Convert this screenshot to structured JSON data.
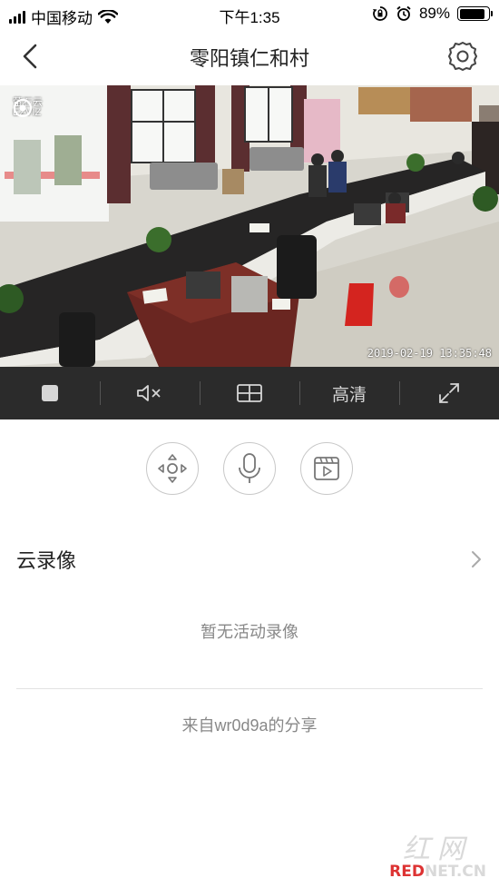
{
  "status_bar": {
    "carrier": "中国移动",
    "time": "下午1:35",
    "battery": "89%",
    "battery_level": 0.89,
    "icons": [
      "signal-icon",
      "wifi-icon",
      "rotation-lock-icon",
      "alarm-icon",
      "battery-icon"
    ]
  },
  "nav": {
    "title": "零阳镇仁和村",
    "back_icon": "chevron-left-icon",
    "settings_icon": "gear-icon"
  },
  "video": {
    "logo_line1": "萤石云",
    "logo_line2": "EZVIZ",
    "timestamp": "2019-02-19 13:35:48"
  },
  "controls": {
    "stop_icon": "stop-icon",
    "mute_icon": "speaker-muted-icon",
    "layout_icon": "multi-screen-icon",
    "quality_label": "高清",
    "fullscreen_icon": "fullscreen-icon"
  },
  "actions": [
    "ptz-direction-icon",
    "microphone-icon",
    "recording-playback-icon"
  ],
  "cloud": {
    "title": "云录像",
    "empty_text": "暂无活动录像",
    "share_text": "来自wr0d9a的分享"
  },
  "watermark": {
    "top": "红网",
    "bottom_red": "RED",
    "bottom_rest": "NET.CN"
  },
  "colors": {
    "control_bar": "#2b2b2b",
    "accent": "#222222",
    "muted_text": "#888888"
  }
}
